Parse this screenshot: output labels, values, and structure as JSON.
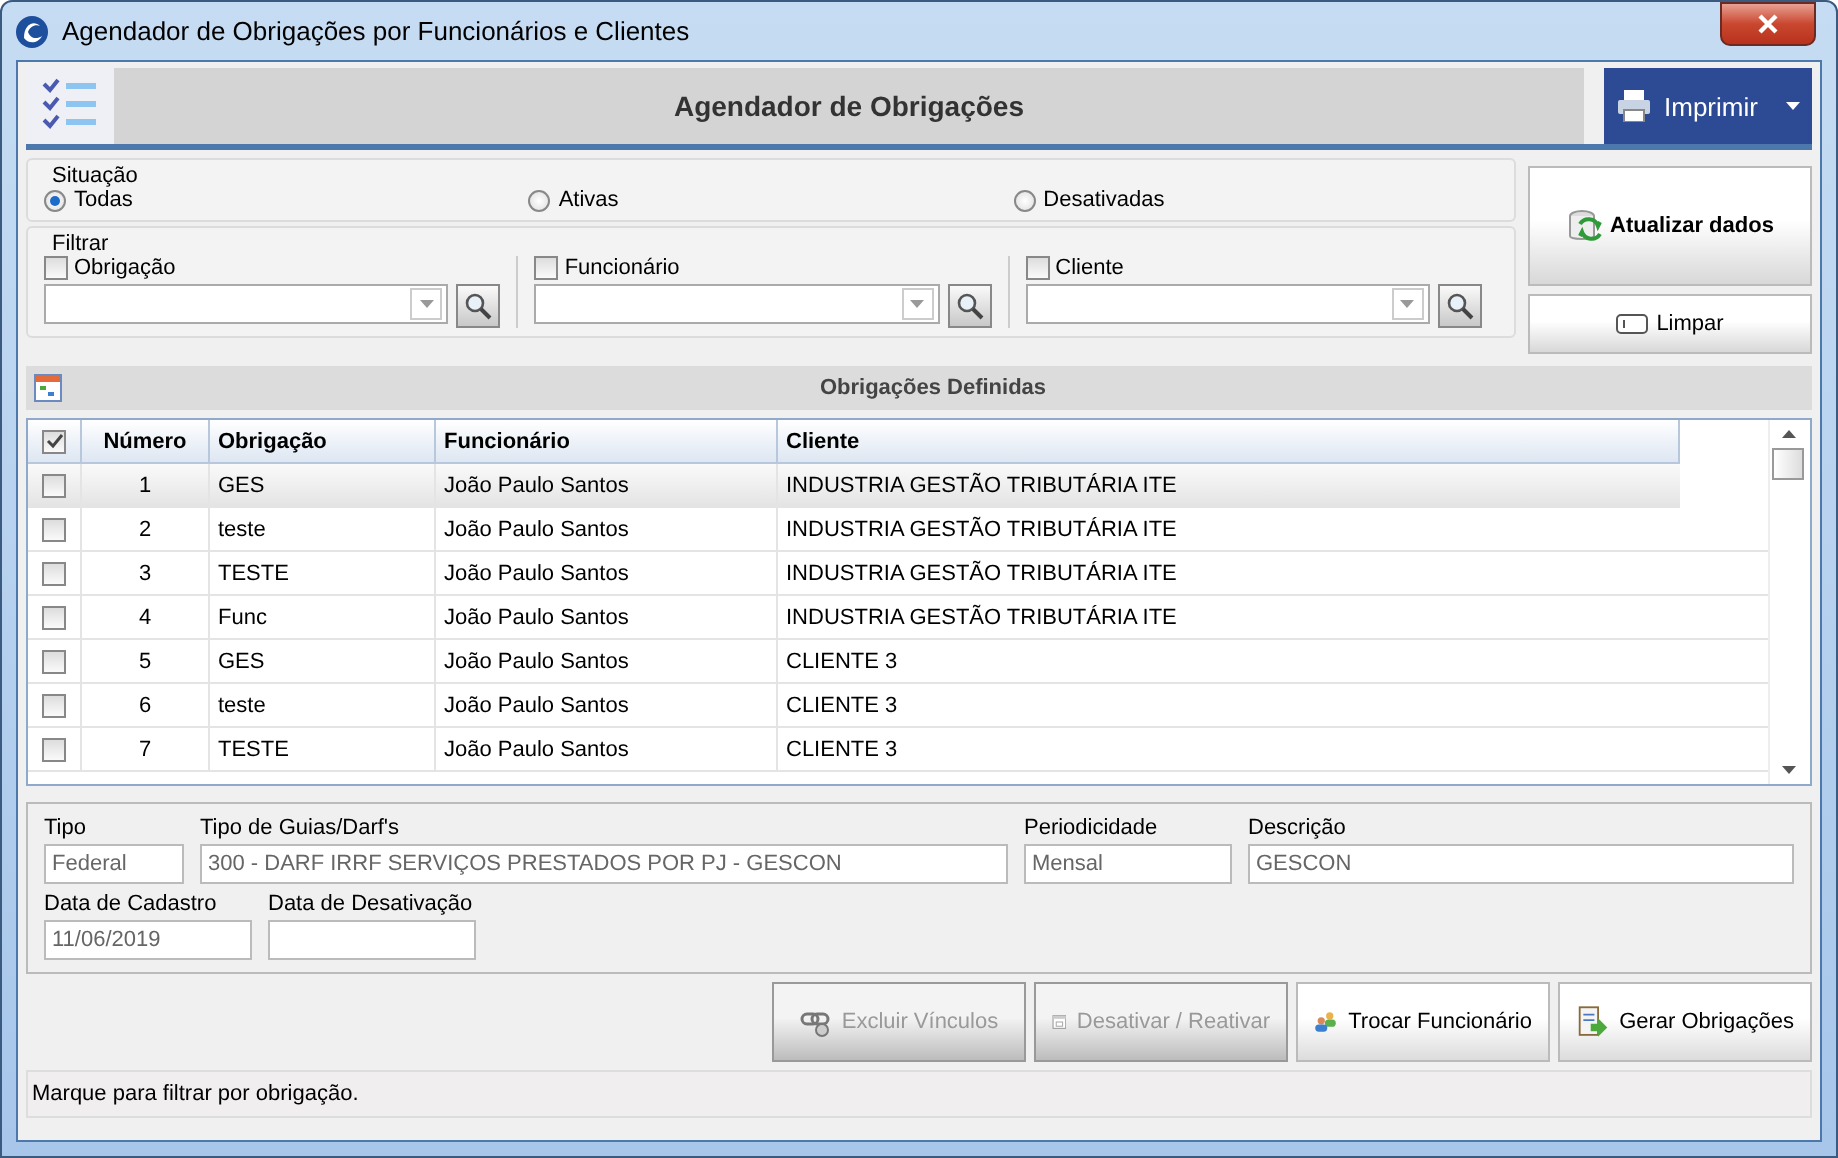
{
  "window": {
    "title": "Agendador de Obrigações por Funcionários e Clientes"
  },
  "header": {
    "title": "Agendador de Obrigações",
    "print_button": "Imprimir"
  },
  "situacao": {
    "label": "Situação",
    "options": [
      {
        "label": "Todas",
        "selected": true
      },
      {
        "label": "Ativas",
        "selected": false
      },
      {
        "label": "Desativadas",
        "selected": false
      }
    ]
  },
  "filtrar": {
    "label": "Filtrar",
    "filters": [
      {
        "label": "Obrigação",
        "checked": false
      },
      {
        "label": "Funcionário",
        "checked": false
      },
      {
        "label": "Cliente",
        "checked": false
      }
    ]
  },
  "side_buttons": {
    "refresh": "Atualizar dados",
    "clear": "Limpar"
  },
  "table": {
    "title": "Obrigações Definidas",
    "all_checked": true,
    "columns": [
      "Número",
      "Obrigação",
      "Funcionário",
      "Cliente"
    ],
    "rows": [
      {
        "checked": false,
        "selected": true,
        "cells": [
          "1",
          "GES",
          "João Paulo Santos",
          "INDUSTRIA GESTÃO TRIBUTÁRIA ITE"
        ]
      },
      {
        "checked": false,
        "selected": false,
        "cells": [
          "2",
          "teste",
          "João Paulo Santos",
          "INDUSTRIA GESTÃO TRIBUTÁRIA ITE"
        ]
      },
      {
        "checked": false,
        "selected": false,
        "cells": [
          "3",
          "TESTE",
          "João Paulo Santos",
          "INDUSTRIA GESTÃO TRIBUTÁRIA ITE"
        ]
      },
      {
        "checked": false,
        "selected": false,
        "cells": [
          "4",
          "Func",
          "João Paulo Santos",
          "INDUSTRIA GESTÃO TRIBUTÁRIA ITE"
        ]
      },
      {
        "checked": false,
        "selected": false,
        "cells": [
          "5",
          "GES",
          "João Paulo Santos",
          "CLIENTE 3"
        ]
      },
      {
        "checked": false,
        "selected": false,
        "cells": [
          "6",
          "teste",
          "João Paulo Santos",
          "CLIENTE 3"
        ]
      },
      {
        "checked": false,
        "selected": false,
        "cells": [
          "7",
          "TESTE",
          "João Paulo Santos",
          "CLIENTE 3"
        ]
      }
    ]
  },
  "details": {
    "row1": [
      {
        "label": "Tipo",
        "value": "Federal"
      },
      {
        "label": "Tipo de Guias/Darf's",
        "value": "300 - DARF IRRF SERVIÇOS PRESTADOS POR PJ - GESCON"
      },
      {
        "label": "Periodicidade",
        "value": "Mensal"
      },
      {
        "label": "Descrição",
        "value": "GESCON"
      }
    ],
    "row2": [
      {
        "label": "Data de Cadastro",
        "value": "11/06/2019"
      },
      {
        "label": "Data de Desativação"
      }
    ]
  },
  "actions": [
    {
      "label": "Excluir Vínculos",
      "kind": "link",
      "disabled": true
    },
    {
      "label": "Desativar / Reativar",
      "kind": "calendar",
      "disabled": true
    },
    {
      "label": "Trocar Funcionário",
      "kind": "people",
      "disabled": false
    },
    {
      "label": "Gerar Obrigações",
      "kind": "generate",
      "disabled": false
    }
  ],
  "status_bar": "Marque para filtrar por obrigação."
}
